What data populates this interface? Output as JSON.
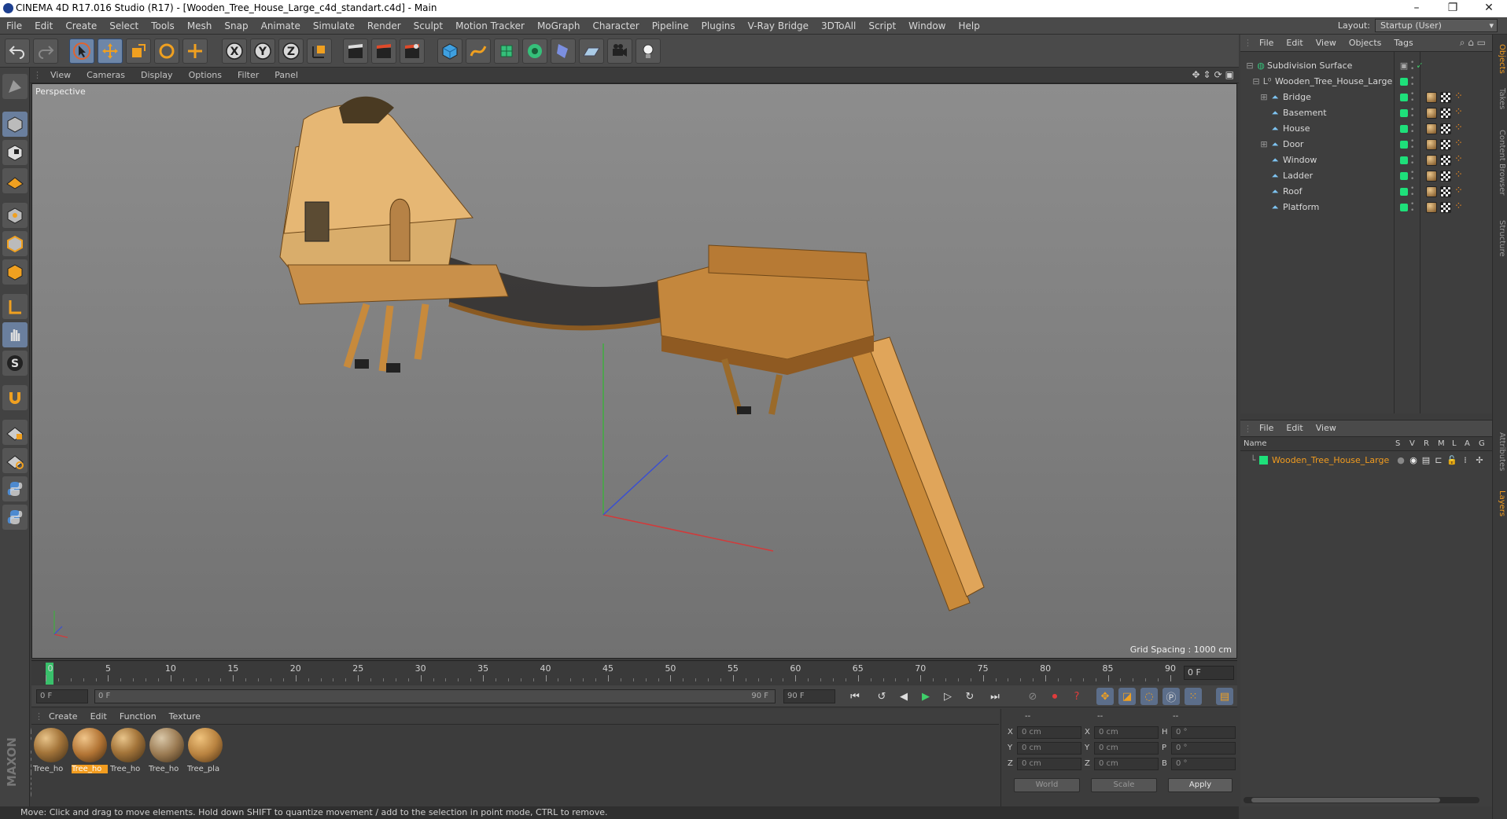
{
  "window": {
    "title": "CINEMA 4D R17.016 Studio (R17) - [Wooden_Tree_House_Large_c4d_standart.c4d] - Main",
    "controls": [
      "–",
      "❐",
      "✕"
    ]
  },
  "menubar": {
    "items": [
      "File",
      "Edit",
      "Create",
      "Select",
      "Tools",
      "Mesh",
      "Snap",
      "Animate",
      "Simulate",
      "Render",
      "Sculpt",
      "Motion Tracker",
      "MoGraph",
      "Character",
      "Pipeline",
      "Plugins",
      "V-Ray Bridge",
      "3DToAll",
      "Script",
      "Window",
      "Help"
    ],
    "layout_label": "Layout:",
    "layout_value": "Startup (User)"
  },
  "toolbar": {
    "axis_x": "X",
    "axis_y": "Y",
    "axis_z": "Z"
  },
  "viewport": {
    "menu": [
      "View",
      "Cameras",
      "Display",
      "Options",
      "Filter",
      "Panel"
    ],
    "camera_label": "Perspective",
    "grid_spacing": "Grid Spacing : 1000 cm"
  },
  "timeline": {
    "ticks": [
      "0",
      "5",
      "10",
      "15",
      "20",
      "25",
      "30",
      "35",
      "40",
      "45",
      "50",
      "55",
      "60",
      "65",
      "70",
      "75",
      "80",
      "85",
      "90"
    ],
    "current_frame": "0 F"
  },
  "transport": {
    "start_field": "0 F",
    "range_start": "0 F",
    "range_end": "90 F",
    "end_field": "90 F"
  },
  "materials": {
    "menu": [
      "Create",
      "Edit",
      "Function",
      "Texture"
    ],
    "items": [
      {
        "name": "Tree_ho",
        "selected": false
      },
      {
        "name": "Tree_ho",
        "selected": true
      },
      {
        "name": "Tree_ho",
        "selected": false
      },
      {
        "name": "Tree_ho",
        "selected": false
      },
      {
        "name": "Tree_pla",
        "selected": false
      }
    ]
  },
  "coordinates": {
    "header": [
      "--",
      "--",
      "--"
    ],
    "pos_labels": [
      "X",
      "Y",
      "Z"
    ],
    "pos_values": [
      "0 cm",
      "0 cm",
      "0 cm"
    ],
    "size_labels": [
      "X",
      "Y",
      "Z"
    ],
    "size_values": [
      "0 cm",
      "0 cm",
      "0 cm"
    ],
    "rot_labels": [
      "H",
      "P",
      "B"
    ],
    "rot_values": [
      "0 °",
      "0 °",
      "0 °"
    ],
    "world": "World",
    "scale": "Scale",
    "apply": "Apply"
  },
  "status": {
    "text": "Move: Click and drag to move elements. Hold down SHIFT to quantize movement / add to the selection in point mode, CTRL to remove."
  },
  "objects_panel": {
    "menu": [
      "File",
      "Edit",
      "View",
      "Objects",
      "Tags"
    ],
    "items": [
      {
        "name": "Subdivision Surface",
        "indent": 0
      },
      {
        "name": "Wooden_Tree_House_Large",
        "indent": 1
      },
      {
        "name": "Bridge",
        "indent": 2
      },
      {
        "name": "Basement",
        "indent": 2
      },
      {
        "name": "House",
        "indent": 2
      },
      {
        "name": "Door",
        "indent": 2
      },
      {
        "name": "Window",
        "indent": 2
      },
      {
        "name": "Ladder",
        "indent": 2
      },
      {
        "name": "Roof",
        "indent": 2
      },
      {
        "name": "Platform",
        "indent": 2
      }
    ]
  },
  "layers_panel": {
    "menu": [
      "File",
      "Edit",
      "View"
    ],
    "columns": [
      "Name",
      "S",
      "V",
      "R",
      "M",
      "L",
      "A",
      "G"
    ],
    "layer_name": "Wooden_Tree_House_Large",
    "layer_color": "#1ee07a"
  },
  "side_tabs": [
    "Objects",
    "Takes",
    "Content Browser",
    "Structure",
    "Attributes",
    "Layers"
  ],
  "colors": {
    "accent_orange": "#f29c1f",
    "visible_green": "#1ee07a",
    "axis_x": "#d23a3a",
    "axis_y": "#3fae3f",
    "axis_z": "#3a4fd2"
  }
}
